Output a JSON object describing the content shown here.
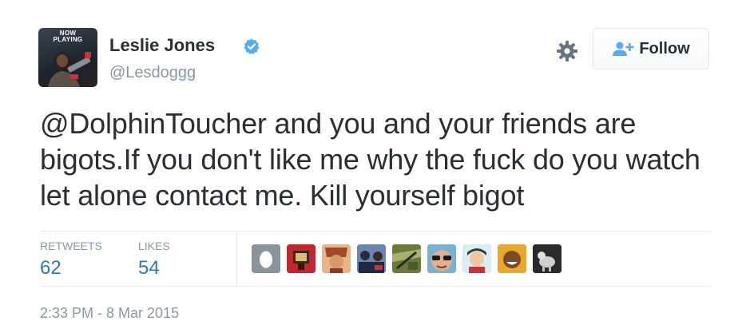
{
  "header": {
    "avatar_badge_line1": "NOW",
    "avatar_badge_line2": "PLAYING",
    "display_name": "Leslie Jones",
    "handle": "@Lesdoggg",
    "follow_label": "Follow"
  },
  "tweet": {
    "text": "@DolphinToucher and you and your friends are bigots.If you don't like me why the fuck do you watch let alone contact me. Kill yourself bigot",
    "timestamp": "2:33 PM - 8 Mar 2015"
  },
  "stats": {
    "retweets_label": "RETWEETS",
    "retweets_value": "62",
    "likes_label": "LIKES",
    "likes_value": "54"
  },
  "likers": [
    {
      "icon": "default-egg-avatar",
      "color": "#9aa4ad"
    },
    {
      "icon": "red-avatar",
      "color": "#c2262f"
    },
    {
      "icon": "cartoon-face-avatar",
      "color": "#c8744a"
    },
    {
      "icon": "group-photo-avatar",
      "color": "#4b6aa0"
    },
    {
      "icon": "landscape-avatar",
      "color": "#7a8c4a"
    },
    {
      "icon": "sunglasses-avatar",
      "color": "#5aa0c8"
    },
    {
      "icon": "cartoon-boy-avatar",
      "color": "#6ab0c0"
    },
    {
      "icon": "smiling-person-avatar",
      "color": "#d89a3a"
    },
    {
      "icon": "dog-photo-avatar",
      "color": "#3a3a3a"
    }
  ],
  "colors": {
    "link_blue": "#2b7bb9",
    "verified_blue": "#55acee",
    "muted_gray": "#8899a6",
    "text_dark": "#292f33"
  }
}
